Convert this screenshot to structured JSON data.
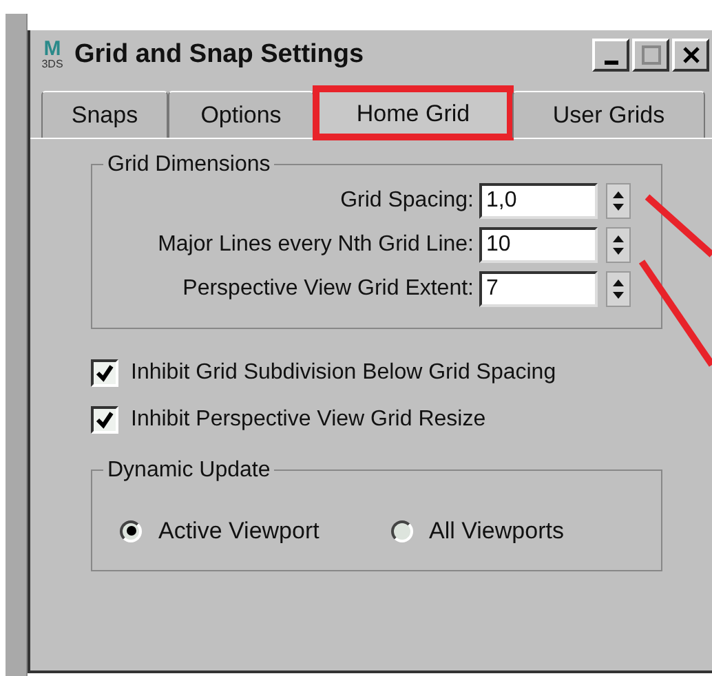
{
  "window": {
    "title": "Grid and Snap Settings",
    "icon": {
      "top": "M",
      "bottom": "3DS"
    }
  },
  "tabs": [
    {
      "label": "Snaps",
      "selected": false,
      "highlighted": false
    },
    {
      "label": "Options",
      "selected": false,
      "highlighted": false
    },
    {
      "label": "Home Grid",
      "selected": true,
      "highlighted": true
    },
    {
      "label": "User Grids",
      "selected": false,
      "highlighted": false
    }
  ],
  "grid_dimensions": {
    "title": "Grid Dimensions",
    "fields": [
      {
        "label": "Grid Spacing:",
        "value": "1,0"
      },
      {
        "label": "Major Lines every Nth Grid Line:",
        "value": "10"
      },
      {
        "label": "Perspective View Grid Extent:",
        "value": "7"
      }
    ]
  },
  "checkboxes": [
    {
      "label": "Inhibit Grid Subdivision Below Grid Spacing",
      "checked": true
    },
    {
      "label": "Inhibit Perspective View Grid Resize",
      "checked": true
    }
  ],
  "dynamic_update": {
    "title": "Dynamic Update",
    "options": [
      {
        "label": "Active Viewport",
        "selected": true
      },
      {
        "label": "All Viewports",
        "selected": false
      }
    ]
  }
}
